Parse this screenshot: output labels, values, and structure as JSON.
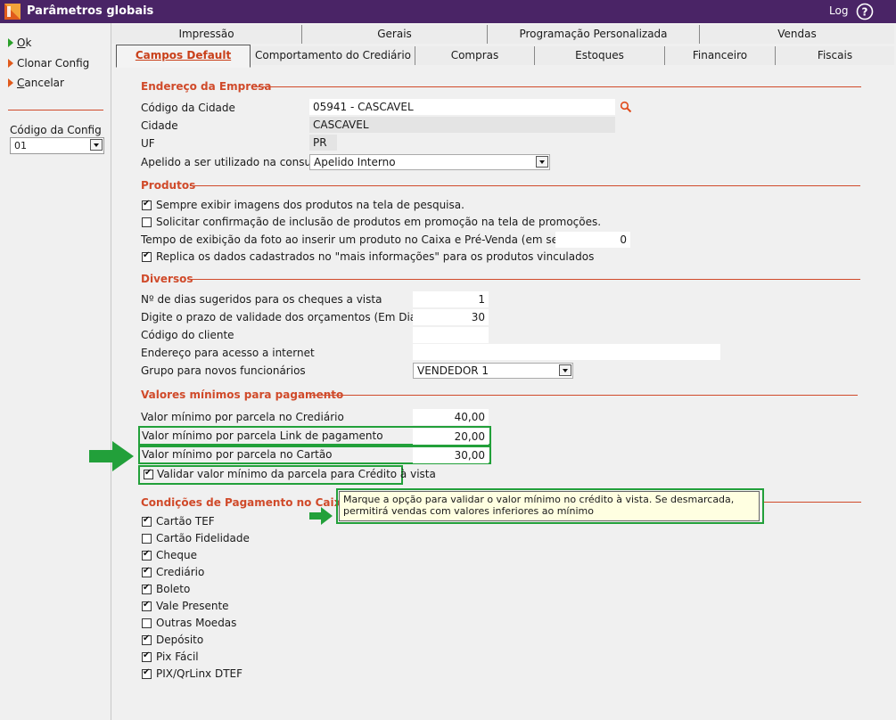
{
  "window": {
    "title": "Parâmetros globais",
    "log": "Log"
  },
  "left": {
    "actions": [
      {
        "label": "Ok",
        "accel": "O",
        "rest": "k"
      },
      {
        "label": "Clonar Config",
        "accel": "",
        "rest": "Clonar Config"
      },
      {
        "label": "Cancelar",
        "accel": "C",
        "rest": "ancelar"
      }
    ],
    "config_code_label": "Código da Config",
    "config_code_value": "01"
  },
  "tabs_row1": [
    "Impressão",
    "Gerais",
    "Programação Personalizada",
    "Vendas"
  ],
  "tabs_row2": [
    "Campos Default",
    "Comportamento do Crediário",
    "Compras",
    "Estoques",
    "Financeiro",
    "Fiscais"
  ],
  "endereco": {
    "title": "Endereço da Empresa",
    "codigo_cidade_label": "Código da Cidade",
    "codigo_cidade_value": "05941 - CASCAVEL",
    "cidade_label": "Cidade",
    "cidade_value": "CASCAVEL",
    "uf_label": "UF",
    "uf_value": "PR",
    "apelido_label": "Apelido a ser utilizado na consulta",
    "apelido_value": "Apelido Interno"
  },
  "produtos": {
    "title": "Produtos",
    "opt_imagens": "Sempre exibir imagens dos produtos na tela de pesquisa.",
    "opt_promocao": "Solicitar confirmação de inclusão de produtos em promoção na tela de promoções.",
    "tempo_label": "Tempo de exibição da foto ao inserir um produto no Caixa e Pré-Venda (em segundos):",
    "tempo_value": "0",
    "opt_replica": "Replica os dados cadastrados no \"mais informações\" para os produtos vinculados"
  },
  "diversos": {
    "title": "Diversos",
    "dias_cheques_label": "Nº de dias sugeridos para os cheques a vista",
    "dias_cheques_value": "1",
    "prazo_label": "Digite o prazo de validade dos orçamentos (Em Dias)",
    "prazo_value": "30",
    "cliente_label": "Código do cliente",
    "cliente_value": "",
    "internet_label": "Endereço para acesso a internet",
    "internet_value": "",
    "grupo_label": "Grupo para novos funcionários",
    "grupo_value": "VENDEDOR 1"
  },
  "valores": {
    "title": "Valores mínimos para pagamento",
    "crediario_label": "Valor mínimo por parcela no Crediário",
    "crediario_value": "40,00",
    "link_label": "Valor mínimo por parcela Link de pagamento",
    "link_value": "20,00",
    "cartao_label": "Valor mínimo por parcela no Cartão",
    "cartao_value": "30,00",
    "validar_label": "Validar valor mínimo da parcela para Crédito à vista"
  },
  "condicoes": {
    "title": "Condições de Pagamento no Caixa",
    "items": [
      {
        "label": "Cartão TEF",
        "checked": true
      },
      {
        "label": "Cartão Fidelidade",
        "checked": false
      },
      {
        "label": "Cheque",
        "checked": true
      },
      {
        "label": "Crediário",
        "checked": true
      },
      {
        "label": "Boleto",
        "checked": true
      },
      {
        "label": "Vale Presente",
        "checked": true
      },
      {
        "label": "Outras Moedas",
        "checked": false
      },
      {
        "label": "Depósito",
        "checked": true
      },
      {
        "label": "Pix Fácil",
        "checked": true
      },
      {
        "label": "PIX/QrLinx DTEF",
        "checked": true
      }
    ]
  },
  "tooltip": "Marque a opção para validar o valor mínimo no crédito à vista. Se desmarcada, permitirá vendas com valores inferiores ao mínimo",
  "colors": {
    "titlebar": "#4a2466",
    "accent": "#d04a2a",
    "highlight": "#22a03a",
    "tooltip_bg": "#ffffe1"
  },
  "icons": [
    "app-logo-icon",
    "help-icon",
    "search-icon",
    "dropdown-arrow-icon",
    "green-arrow-icon"
  ]
}
